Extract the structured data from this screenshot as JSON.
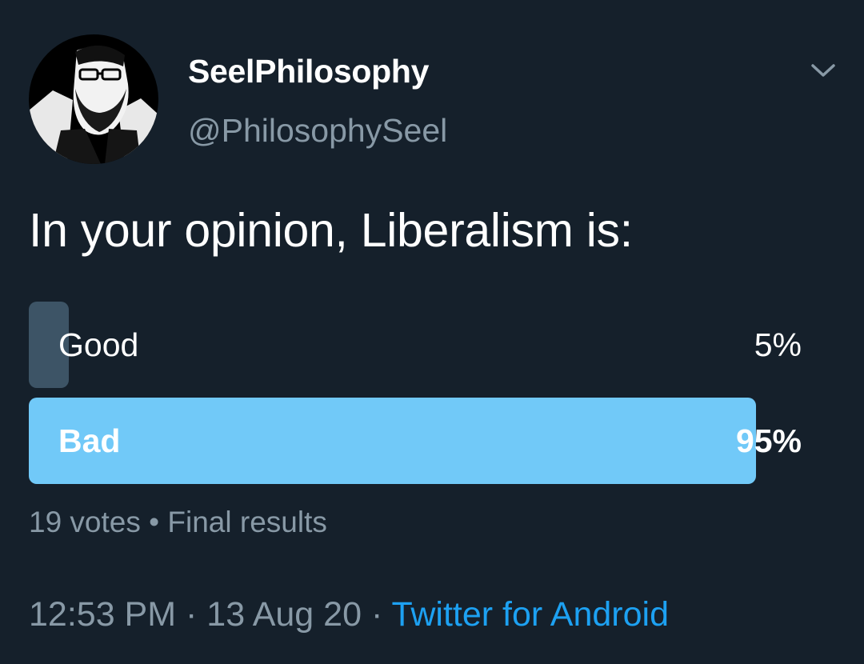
{
  "user": {
    "display_name": "SeelPhilosophy",
    "handle": "@PhilosophySeel"
  },
  "tweet": {
    "text": "In your opinion, Liberalism is:"
  },
  "poll": {
    "options": [
      {
        "label": "Good",
        "percent_text": "5%",
        "percent": 5,
        "winner": false
      },
      {
        "label": "Bad",
        "percent_text": "95%",
        "percent": 95,
        "winner": true
      }
    ],
    "votes": "19 votes",
    "separator": "•",
    "status": "Final results"
  },
  "meta": {
    "time": "12:53 PM",
    "date": "13 Aug 20",
    "separator": "·",
    "source": "Twitter for Android"
  },
  "colors": {
    "background": "#15202B",
    "secondary_text": "#8899A6",
    "winner_bar": "#71C9F8",
    "loser_bar": "#3D5466",
    "link": "#1DA1F2"
  },
  "icons": {
    "menu": "chevron-down-icon",
    "avatar": "profile-photo"
  }
}
